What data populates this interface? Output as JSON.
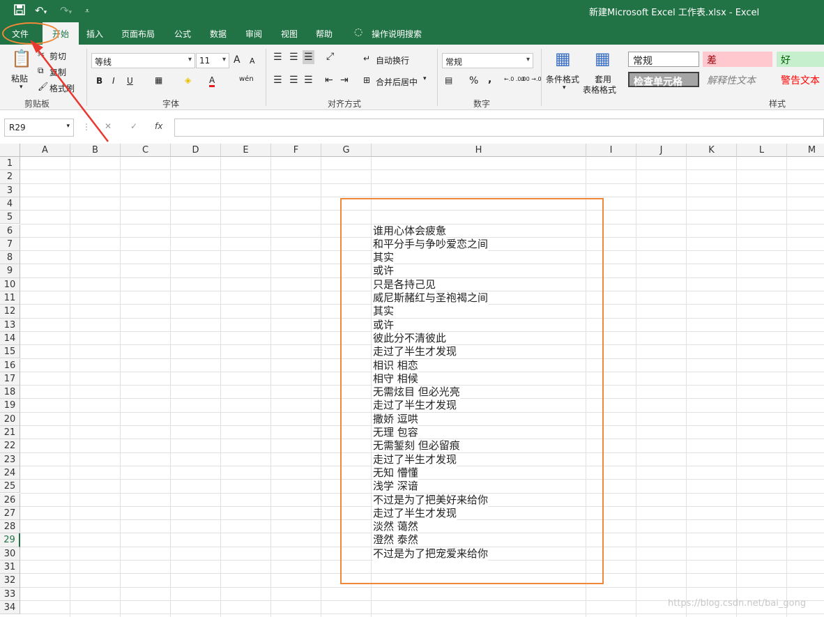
{
  "window": {
    "title": "新建Microsoft Excel 工作表.xlsx  -  Excel"
  },
  "quick_access": {
    "save_icon": "save-icon",
    "undo_icon": "undo-icon",
    "redo_icon": "redo-icon",
    "customize_icon": "customize-icon"
  },
  "tabs": [
    "文件",
    "开始",
    "插入",
    "页面布局",
    "公式",
    "数据",
    "审阅",
    "视图",
    "帮助"
  ],
  "tell_me": "操作说明搜索",
  "ribbon": {
    "clipboard": {
      "paste": "粘贴",
      "cut": "剪切",
      "copy": "复制",
      "format_painter": "格式刷",
      "label": "剪贴板"
    },
    "font": {
      "name": "等线",
      "size": "11",
      "bold": "B",
      "italic": "I",
      "underline": "U",
      "label": "字体",
      "grow": "A",
      "shrink": "A",
      "phonetic": "wén",
      "font_color": "A"
    },
    "alignment": {
      "wrap": "自动换行",
      "merge": "合并后居中",
      "label": "对齐方式"
    },
    "number": {
      "format": "常规",
      "percent": "%",
      "comma": ",",
      "label": "数字",
      "increase_dec": "←.0 .00",
      "decrease_dec": ".00 →.0"
    },
    "styles": {
      "conditional": "条件格式",
      "table_format_1": "套用",
      "table_format_2": "表格格式",
      "normal": "常规",
      "bad": "差",
      "good": "好",
      "check_cell": "检查单元格",
      "explanatory": "解释性文本",
      "warning": "警告文本",
      "label": "样式"
    }
  },
  "name_box": "R29",
  "formula_icons": {
    "cancel": "✕",
    "enter": "✓",
    "fx": "fx"
  },
  "columns": [
    "A",
    "B",
    "C",
    "D",
    "E",
    "F",
    "G",
    "H",
    "I",
    "J",
    "K",
    "L",
    "M"
  ],
  "rows": [
    "1",
    "2",
    "3",
    "4",
    "5",
    "6",
    "7",
    "8",
    "9",
    "10",
    "11",
    "12",
    "13",
    "14",
    "15",
    "16",
    "17",
    "18",
    "19",
    "20",
    "21",
    "22",
    "23",
    "24",
    "25",
    "26",
    "27",
    "28",
    "29",
    "30",
    "31",
    "32",
    "33",
    "34"
  ],
  "selected_row": "29",
  "cells_H": [
    "谁用心体会疲惫",
    "和平分手与争吵爱恋之间",
    "其实",
    "或许",
    "只是各持己见",
    "威尼斯赭红与圣袍褐之间",
    "其实",
    "或许",
    "彼此分不清彼此",
    "走过了半生才发现",
    "相识 相恋",
    "相守 相候",
    "无需炫目 但必光亮",
    "走过了半生才发现",
    "撒娇 逗哄",
    "无理 包容",
    "无需錾刻 但必留痕",
    "走过了半生才发现",
    "无知 懵懂",
    "浅学 深谙",
    "不过是为了把美好来给你",
    "走过了半生才发现",
    "淡然 蔼然",
    "澄然 泰然",
    "不过是为了把宠爱来给你"
  ],
  "watermark": "https://blog.csdn.net/bai_gong",
  "colors": {
    "excel_green": "#217346",
    "annotation_orange": "#f0883a",
    "arrow_red": "#e8382f"
  }
}
